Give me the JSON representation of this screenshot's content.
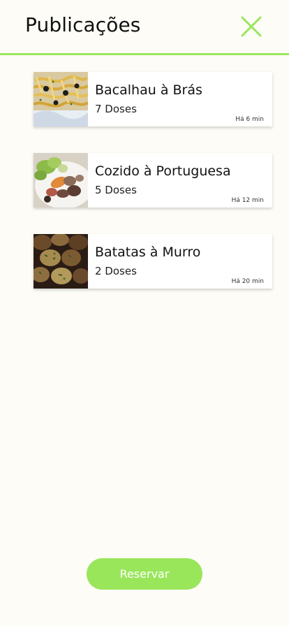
{
  "header": {
    "title": "Publicações",
    "close_icon": "close-icon"
  },
  "colors": {
    "accent": "#9ae65b",
    "background": "#fdfcf6"
  },
  "publications": [
    {
      "name": "Bacalhau à Brás",
      "doses": "7 Doses",
      "time": "Há 6 min",
      "image": "bacalhau-photo"
    },
    {
      "name": "Cozido à Portuguesa",
      "doses": "5 Doses",
      "time": "Há 12 min",
      "image": "cozido-photo"
    },
    {
      "name": "Batatas à Murro",
      "doses": "2 Doses",
      "time": "Há 20 min",
      "image": "batatas-photo"
    }
  ],
  "footer": {
    "reserve_label": "Reservar"
  }
}
